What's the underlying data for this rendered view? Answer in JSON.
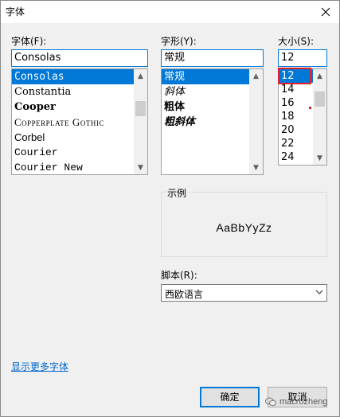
{
  "window": {
    "title": "字体"
  },
  "font": {
    "label": "字体(F):",
    "value": "Consolas",
    "items": [
      "Consolas",
      "Constantia",
      "Cooper",
      "Copperplate Gothic",
      "Corbel",
      "Courier",
      "Courier New"
    ],
    "selected_index": 0
  },
  "style": {
    "label": "字形(Y):",
    "value": "常规",
    "items": [
      "常规",
      "斜体",
      "粗体",
      "粗斜体"
    ],
    "selected_index": 0
  },
  "size": {
    "label": "大小(S):",
    "value": "12",
    "items": [
      "12",
      "14",
      "16",
      "18",
      "20",
      "22",
      "24"
    ],
    "selected_index": 0
  },
  "sample": {
    "caption": "示例",
    "text": "AaBbYyZz"
  },
  "script": {
    "label": "脚本(R):",
    "value": "西欧语言"
  },
  "more_fonts_link": "显示更多字体",
  "buttons": {
    "ok": "确定",
    "cancel": "取消"
  },
  "watermark": {
    "text": "macrozheng"
  },
  "colors": {
    "accent": "#0078d7",
    "highlight_box": "#e0202a",
    "link": "#0066cc"
  }
}
